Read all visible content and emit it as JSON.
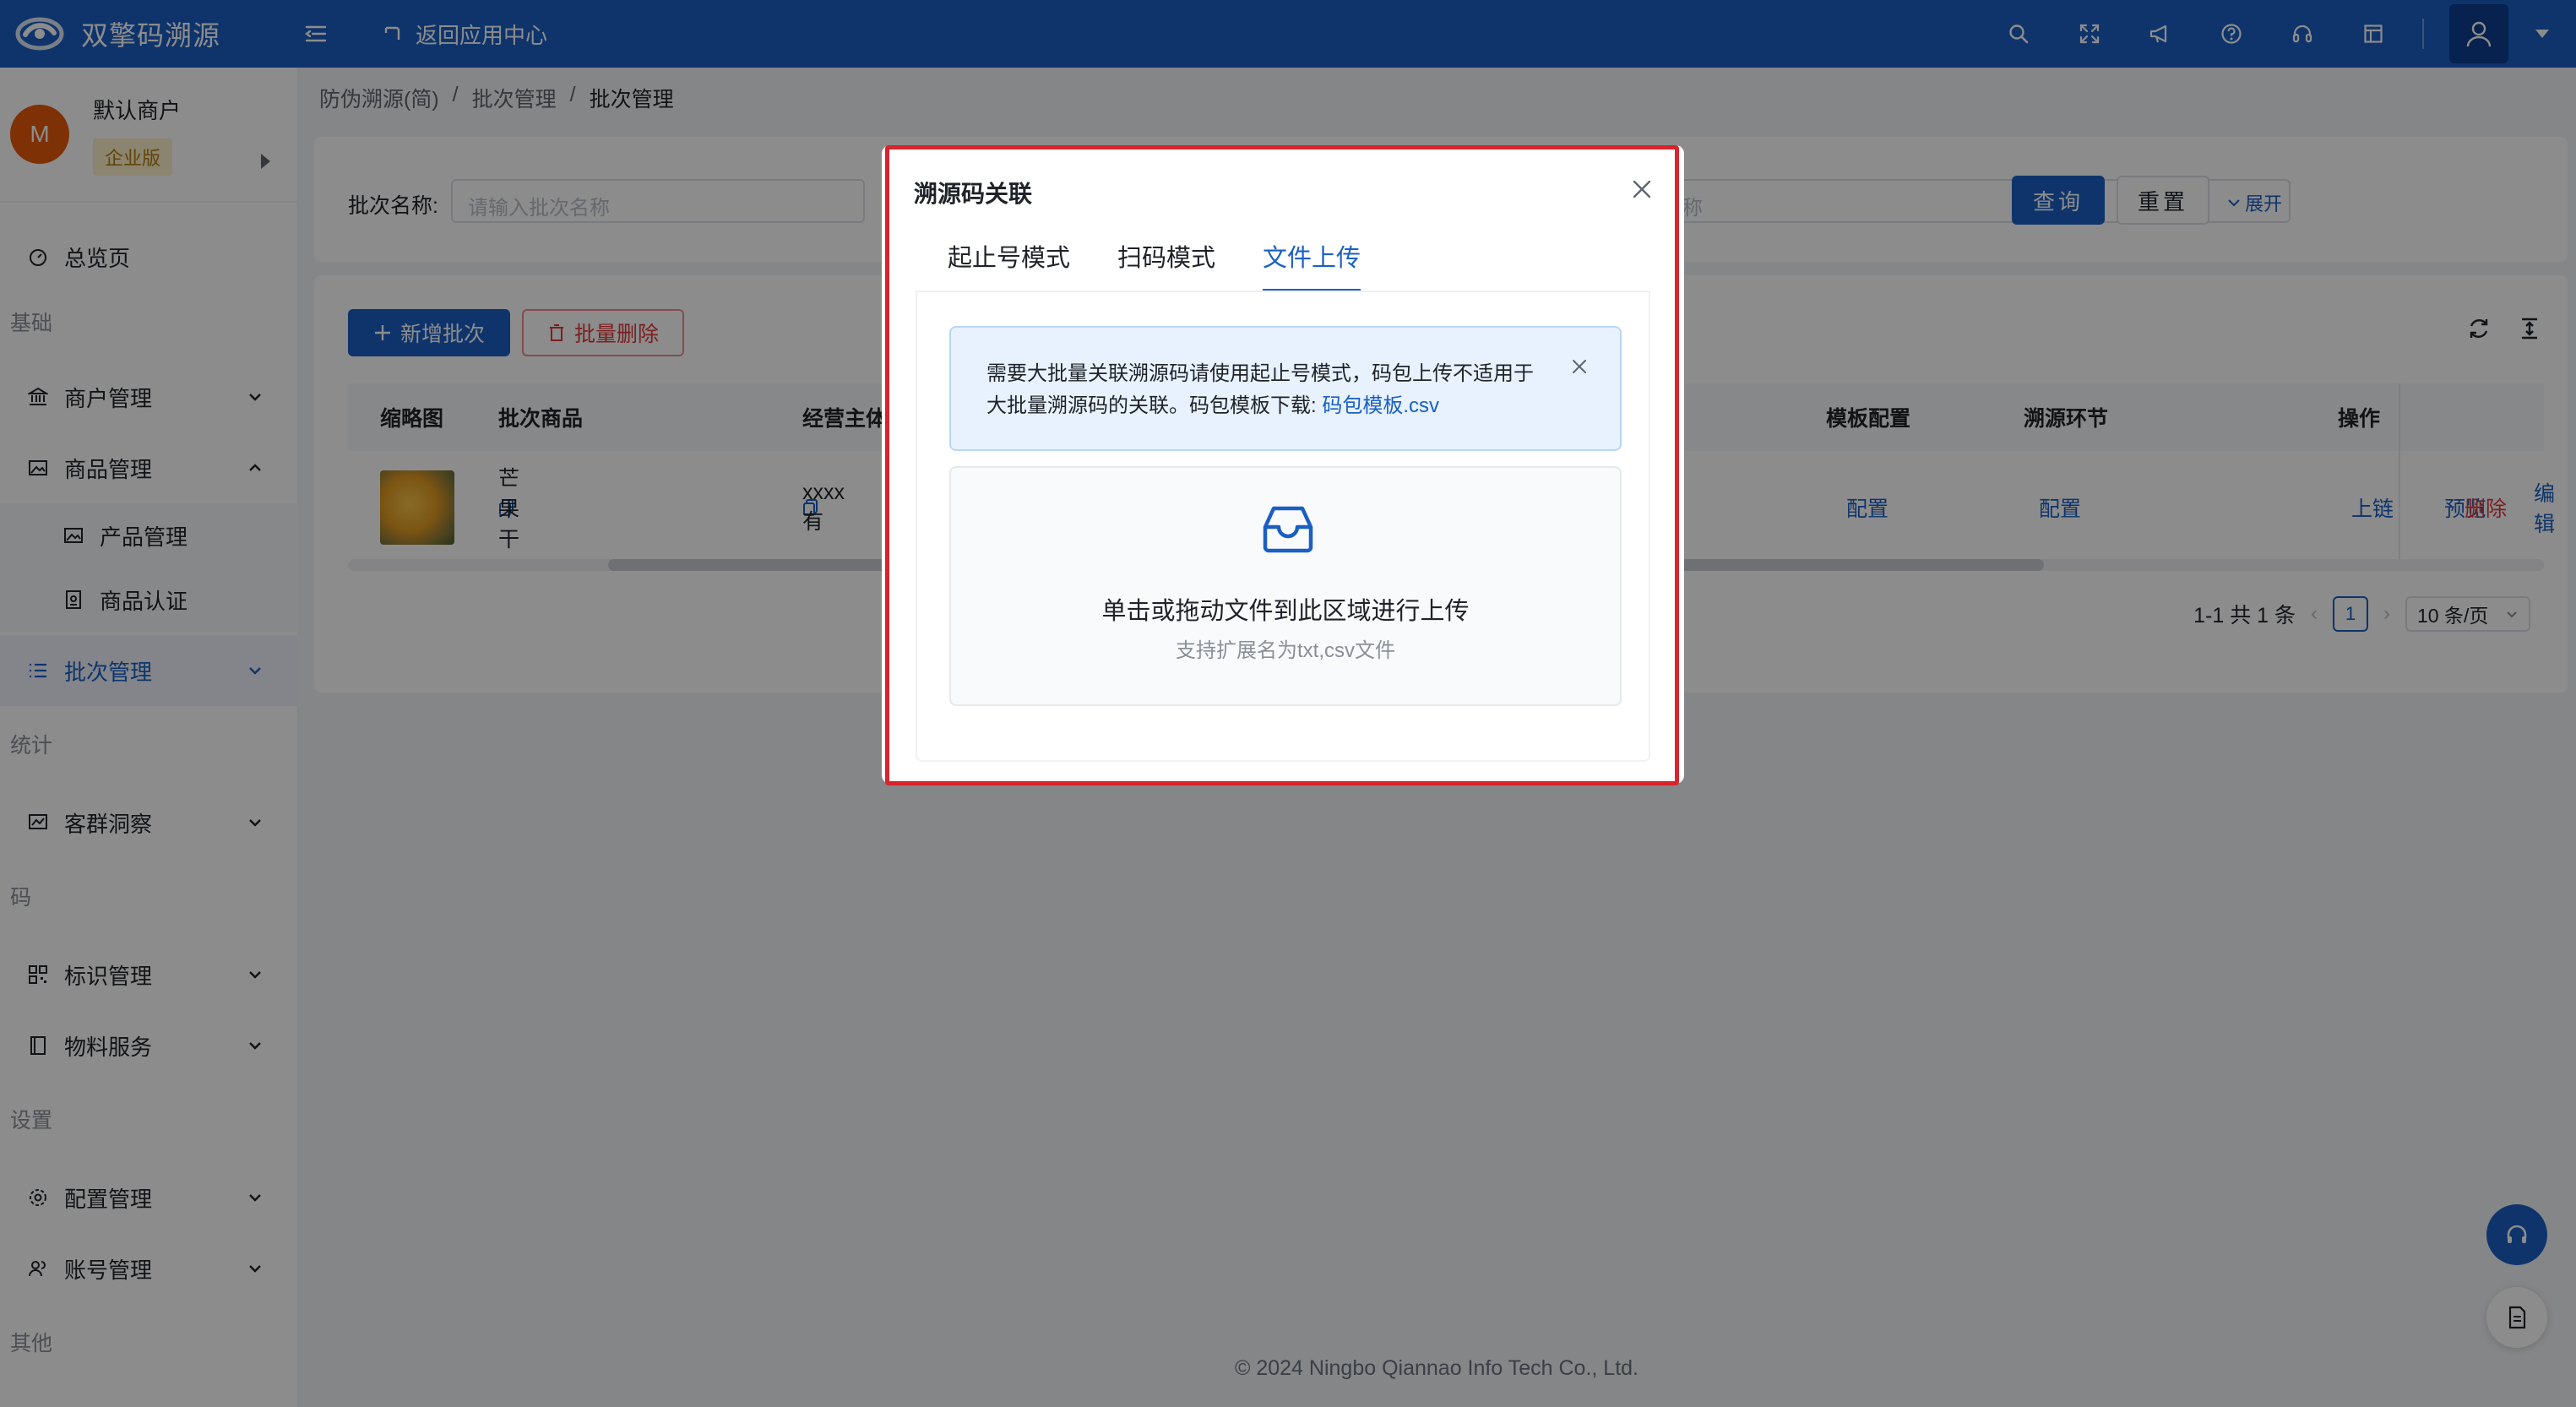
{
  "header": {
    "brand_name": "双擎码溯源",
    "back_label": "返回应用中心",
    "tools": [
      "search-icon",
      "fullscreen-icon",
      "megaphone-icon",
      "help-icon",
      "headset-icon",
      "layout-icon"
    ]
  },
  "sidebar": {
    "merchant": {
      "avatar_letter": "M",
      "name": "默认商户",
      "badge": "企业版"
    },
    "overview": "总览页",
    "groups": {
      "basic": "基础",
      "stats": "统计",
      "code": "码",
      "settings": "设置",
      "other": "其他"
    },
    "items": {
      "merchant_mgmt": "商户管理",
      "product_mgmt": "商品管理",
      "product_sub": "产品管理",
      "product_cert": "商品认证",
      "batch_mgmt": "批次管理",
      "customer_insight": "客群洞察",
      "id_mgmt": "标识管理",
      "material_service": "物料服务",
      "config_mgmt": "配置管理",
      "account_mgmt": "账号管理"
    }
  },
  "breadcrumb": [
    "防伪溯源(简)",
    "批次管理",
    "批次管理"
  ],
  "search": {
    "label": "批次名称:",
    "placeholder": "请输入批次名称",
    "placeholder2": "称",
    "query": "查询",
    "reset": "重置",
    "expand": "展开"
  },
  "table": {
    "add": "新增批次",
    "batch_delete": "批量删除",
    "headers": {
      "thumb": "缩略图",
      "product": "批次商品",
      "entity": "经营主体",
      "template": "模板配置",
      "trace": "溯源环节",
      "ops": "操作"
    },
    "row": {
      "product": "芒果干",
      "entity": "xxxx有",
      "template": "配置",
      "trace": "配置",
      "ops": {
        "preview": "预览",
        "edit": "编辑",
        "chain": "上链",
        "delete": "删除"
      }
    }
  },
  "pagination": {
    "summary": "1-1 共 1 条",
    "current": "1",
    "page_size": "10 条/页"
  },
  "footer": "© 2024 Ningbo Qiannao Info Tech Co., Ltd.",
  "modal": {
    "title": "溯源码关联",
    "tabs": [
      "起止号模式",
      "扫码模式",
      "文件上传"
    ],
    "active_tab": 2,
    "alert_text": "需要大批量关联溯源码请使用起止号模式，码包上传不适用于大批量溯源码的关联。码包模板下载: ",
    "alert_link": "码包模板.csv",
    "dropzone_title": "单击或拖动文件到此区域进行上传",
    "dropzone_hint": "支持扩展名为txt,csv文件"
  },
  "colors": {
    "primary": "#1a5fc4",
    "danger": "#e03a3a",
    "highlight": "#d9232d"
  }
}
